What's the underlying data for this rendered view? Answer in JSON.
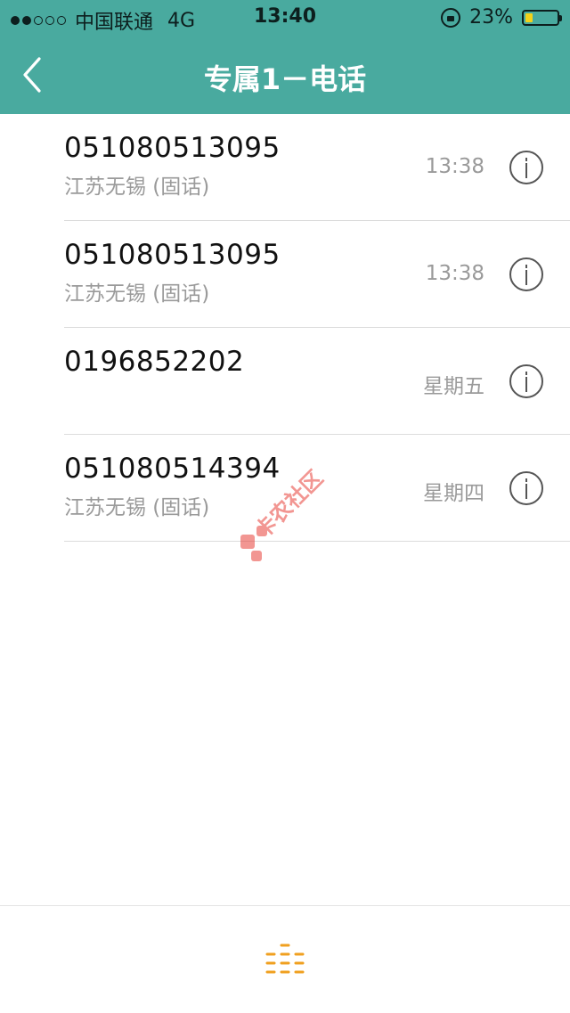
{
  "status_bar": {
    "carrier": "中国联通",
    "network": "4G",
    "time": "13:40",
    "battery_percent": "23%",
    "battery_level": 0.23,
    "signal_dots_filled": 2,
    "signal_dots_total": 5
  },
  "nav": {
    "title": "专属1－电话",
    "back_icon": "chevron-left-icon"
  },
  "calls": [
    {
      "number": "051080513095",
      "location": "江苏无锡 (固话)",
      "time": "13:38"
    },
    {
      "number": "051080513095",
      "location": "江苏无锡 (固话)",
      "time": "13:38"
    },
    {
      "number": "0196852202",
      "location": "",
      "time": "星期五"
    },
    {
      "number": "051080514394",
      "location": "江苏无锡 (固话)",
      "time": "星期四"
    }
  ],
  "watermark": {
    "text": "卡农社区"
  },
  "toolbar": {
    "keypad_icon": "keypad-icon"
  },
  "colors": {
    "header": "#49aa9f",
    "keypad": "#f0a020",
    "watermark": "#e8413a"
  }
}
